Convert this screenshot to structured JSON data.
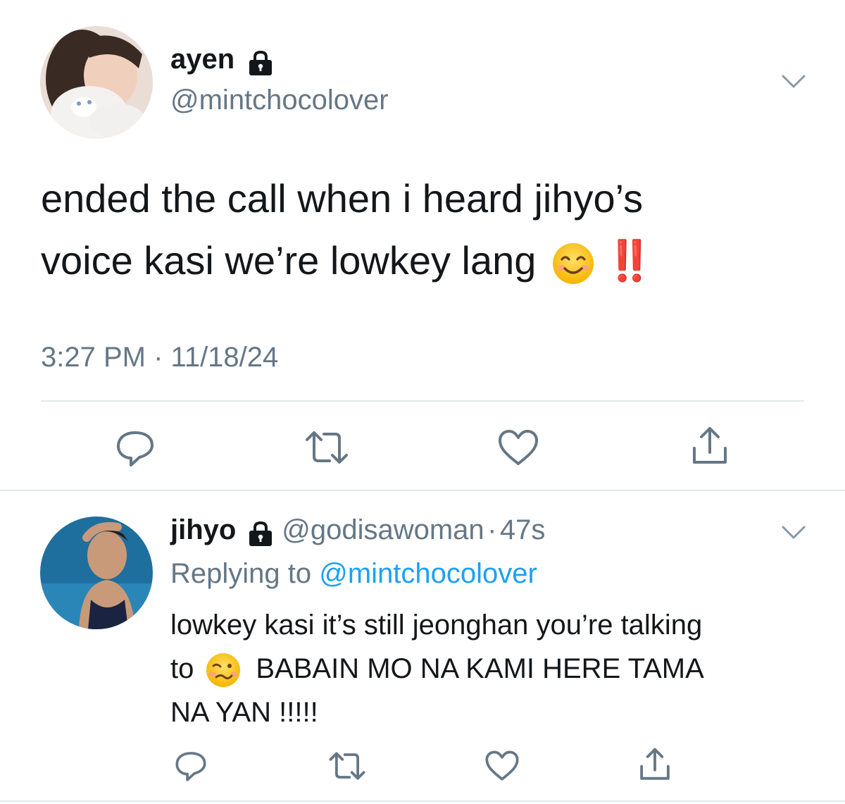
{
  "tweet": {
    "name": "ayen",
    "handle": "@mintchocolover",
    "text_line1": "ended the call when i heard jihyo’s",
    "text_line2": "voice kasi we’re lowkey lang",
    "bangbang": "‼️",
    "time": "3:27 PM",
    "date_sep": "·",
    "date": "11/18/24"
  },
  "reply": {
    "name": "jihyo",
    "handle": "@godisawoman",
    "time_sep": "·",
    "time": "47s",
    "replying_prefix": "Replying to",
    "replying_to": "@mintchocolover",
    "text_line1": "lowkey kasi it’s still jeonghan you’re talking",
    "text_line2_a": "to",
    "text_line2_b": "BABAIN MO NA KAMI HERE TAMA",
    "text_line3": "NA YAN !!!!!"
  },
  "icons": {
    "reply": "reply-icon",
    "retweet": "retweet-icon",
    "like": "heart-icon",
    "share": "share-icon",
    "lock": "lock-icon",
    "chevron": "chevron-down-icon"
  },
  "colors": {
    "link": "#1da1f2",
    "secondary": "#657786",
    "text": "#14171a",
    "divider": "#e1e8ed",
    "bangbang": "#e0241e"
  }
}
